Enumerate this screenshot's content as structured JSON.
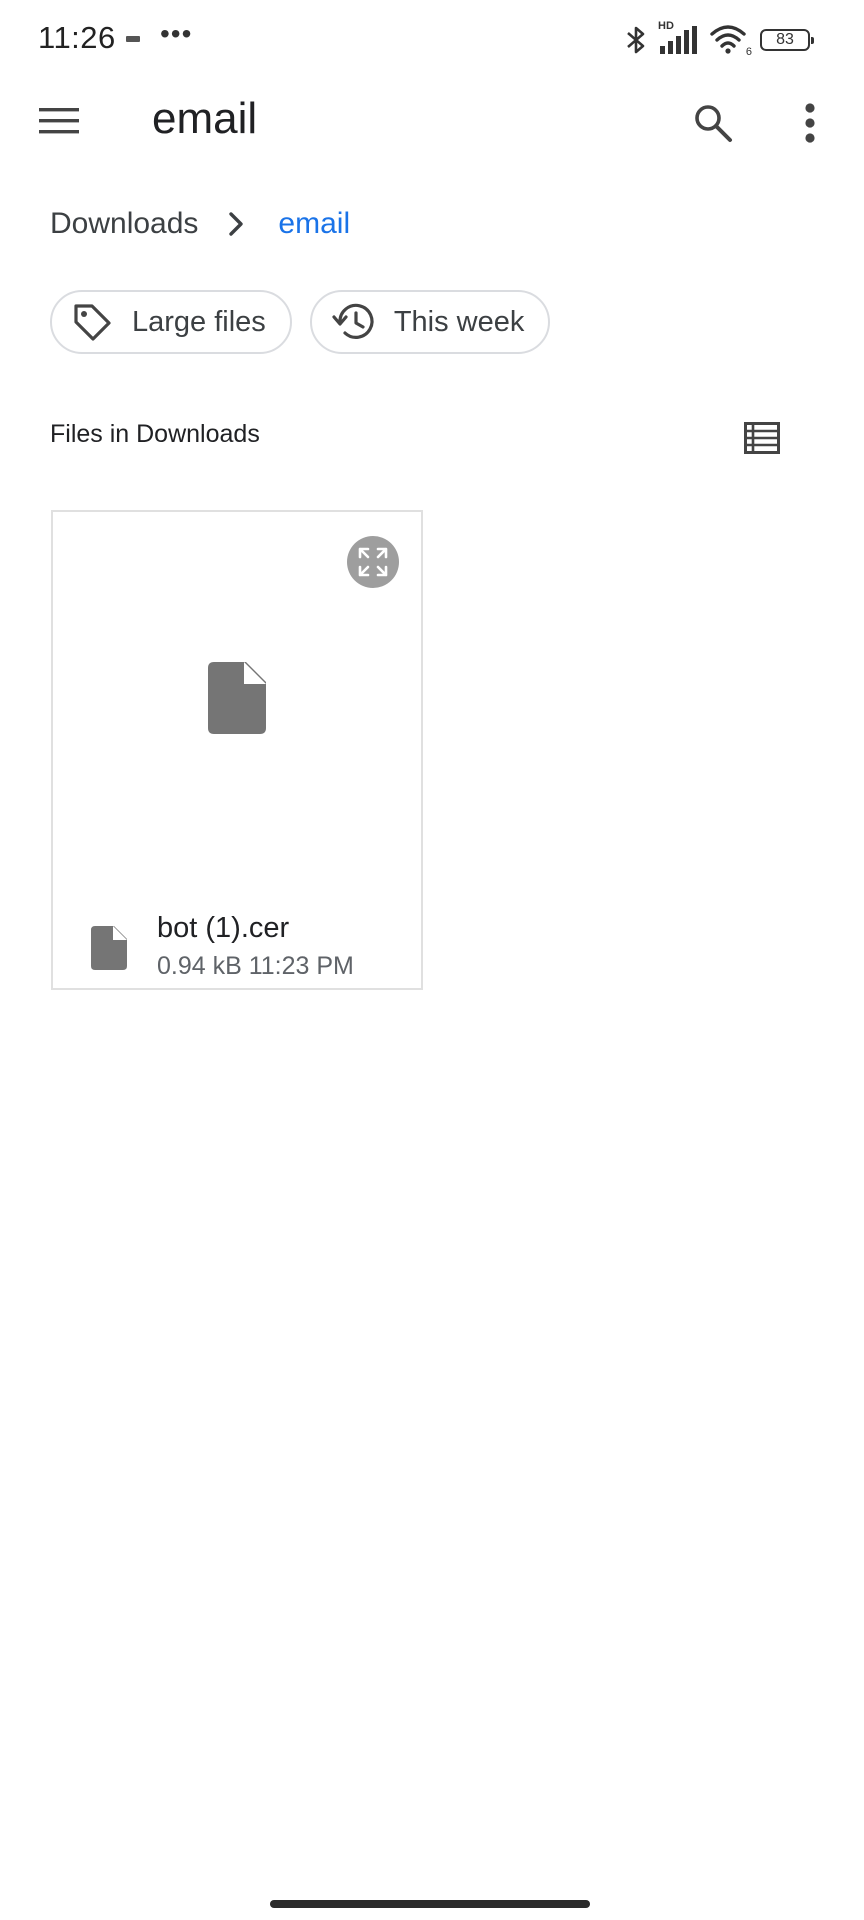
{
  "status_bar": {
    "time": "11:26",
    "more_indicator": "•••",
    "battery_level": "83",
    "network_label": "HD",
    "wifi_tag": "6",
    "icons": [
      "notification-icon",
      "bluetooth-icon",
      "cell-signal-icon",
      "wifi-icon",
      "battery-icon"
    ]
  },
  "app_bar": {
    "title": "email",
    "icons": [
      "menu-icon",
      "search-icon",
      "more-vert-icon"
    ]
  },
  "breadcrumb": {
    "root": "Downloads",
    "current": "email"
  },
  "filters": [
    {
      "label": "Large files",
      "icon": "tag-icon"
    },
    {
      "label": "This week",
      "icon": "history-icon"
    }
  ],
  "section": {
    "title": "Files in Downloads",
    "view_icon": "list-view-icon"
  },
  "files": [
    {
      "name": "bot (1).cer",
      "size": "0.94 kB",
      "time": "11:23 PM",
      "icon": "file-icon"
    }
  ],
  "colors": {
    "accent": "#1a73e8",
    "text_primary": "#202124",
    "text_secondary": "#5f6368",
    "chip_border": "#dadce0",
    "file_icon": "#757575"
  }
}
